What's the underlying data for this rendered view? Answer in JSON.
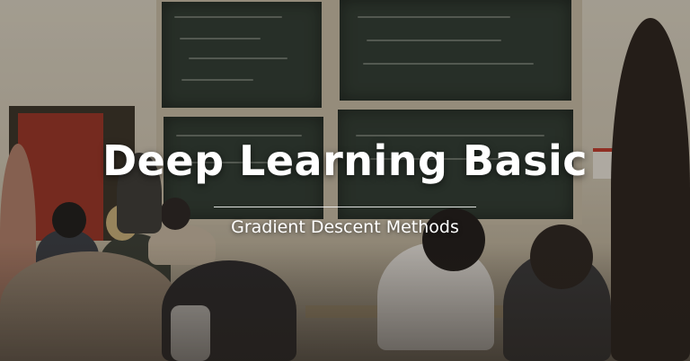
{
  "banner": {
    "title": "Deep Learning Basic",
    "subtitle": "Gradient Descent Methods"
  }
}
